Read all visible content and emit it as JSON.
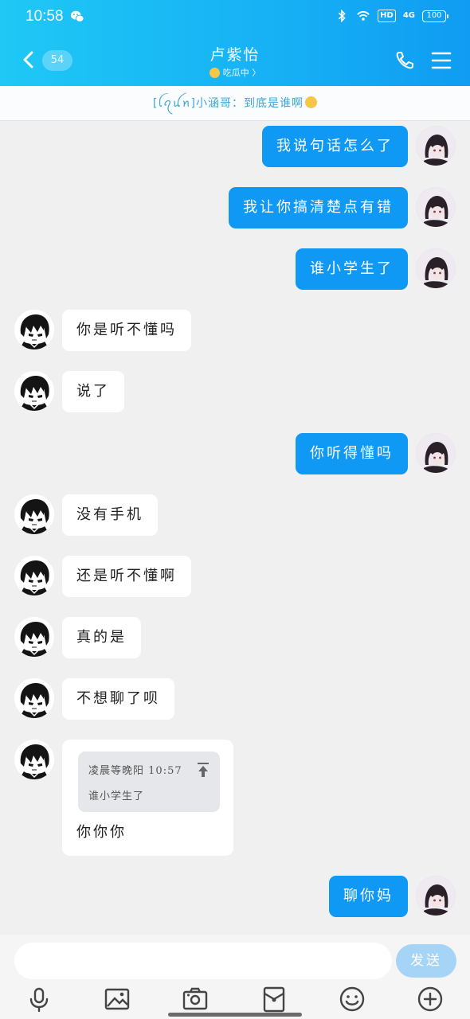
{
  "status_bar": {
    "time": "10:58",
    "network": "4G",
    "hd": "HD",
    "battery": "100"
  },
  "header": {
    "unread_count": "54",
    "title": "卢紫怡",
    "subtitle": "吃瓜中 〉"
  },
  "banner": {
    "text": "[ꪶꪖꪊꪀ]小涵哥：到底是谁啊"
  },
  "messages": [
    {
      "side": "out",
      "text": "我说句话怎么了"
    },
    {
      "side": "out",
      "text": "我让你搞清楚点有错"
    },
    {
      "side": "out",
      "text": "谁小学生了"
    },
    {
      "side": "in",
      "text": "你是听不懂吗"
    },
    {
      "side": "in",
      "text": "说了"
    },
    {
      "side": "out",
      "text": "你听得懂吗"
    },
    {
      "side": "in",
      "text": "没有手机"
    },
    {
      "side": "in",
      "text": "还是听不懂啊"
    },
    {
      "side": "in",
      "text": "真的是"
    },
    {
      "side": "in",
      "text": "不想聊了呗"
    }
  ],
  "reply_message": {
    "quote_sender": "凌晨等晚阳",
    "quote_time": "10:57",
    "quote_text": "谁小学生了",
    "text": "你你你"
  },
  "last_message": {
    "side": "out",
    "text": "聊你妈"
  },
  "input": {
    "placeholder": "",
    "send_label": "发送"
  },
  "colors": {
    "accent": "#0f98f4",
    "header_start": "#1fc8f5",
    "header_end": "#0f9cf2",
    "bubble_in": "#ffffff",
    "background": "#f0f0f0"
  },
  "icons": {
    "toolbar": [
      "microphone-icon",
      "image-icon",
      "camera-icon",
      "red-packet-icon",
      "emoji-icon",
      "plus-icon"
    ]
  }
}
